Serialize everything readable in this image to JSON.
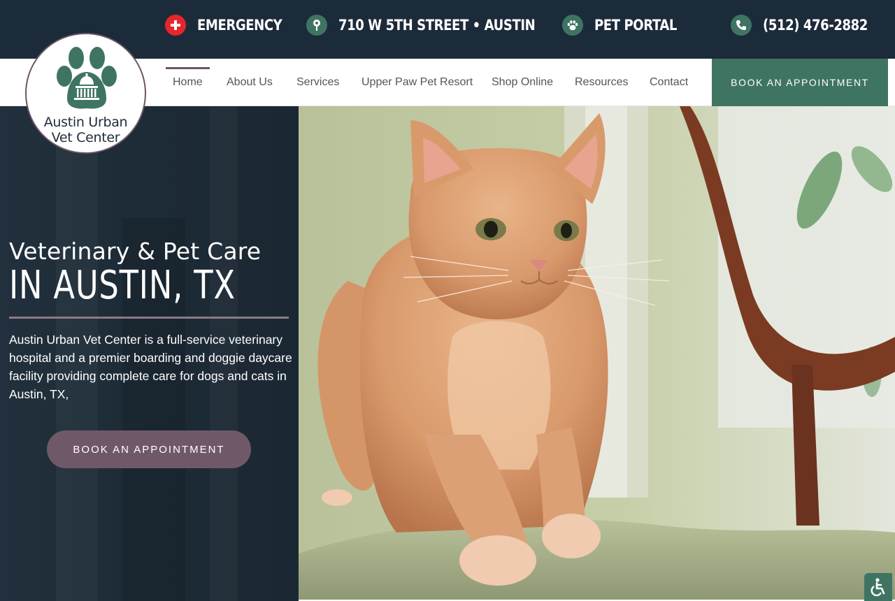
{
  "topbar": {
    "emergency": {
      "label": "EMERGENCY",
      "icon": "plus-icon",
      "icon_color": "#e5262d"
    },
    "address": {
      "label": "710 W 5TH STREET • AUSTIN",
      "icon": "map-pin-icon",
      "icon_color": "#3f7463"
    },
    "portal": {
      "label": "PET PORTAL",
      "icon": "paw-icon",
      "icon_color": "#3f7463"
    },
    "phone": {
      "label": "(512) 476-2882",
      "icon": "phone-icon",
      "icon_color": "#3f7463"
    }
  },
  "logo": {
    "line1": "Austin Urban",
    "line2": "Vet Center",
    "icon": "paw-capitol-logo"
  },
  "nav": {
    "items": [
      {
        "label": "Home",
        "active": true
      },
      {
        "label": "About Us"
      },
      {
        "label": "Services"
      },
      {
        "label": "Upper Paw Pet Resort"
      },
      {
        "label": "Shop Online"
      },
      {
        "label": "Resources"
      },
      {
        "label": "Contact"
      }
    ],
    "cta": "BOOK AN APPOINTMENT"
  },
  "hero": {
    "title_line1": "Veterinary & Pet Care",
    "title_line2": "IN AUSTIN, TX",
    "description": "Austin Urban Vet Center is a full-service veterinary hospital and a premier boarding and doggie daycare facility providing complete care for dogs and cats in Austin, TX,",
    "cta": "BOOK AN APPOINTMENT",
    "image": "orange-tabby-cat-on-chair"
  },
  "accessibility": {
    "icon": "wheelchair-icon"
  },
  "colors": {
    "topbar_bg": "#1c2b3a",
    "brand_green": "#3f7463",
    "brand_mauve": "#6f5968",
    "emergency_red": "#e5262d"
  }
}
